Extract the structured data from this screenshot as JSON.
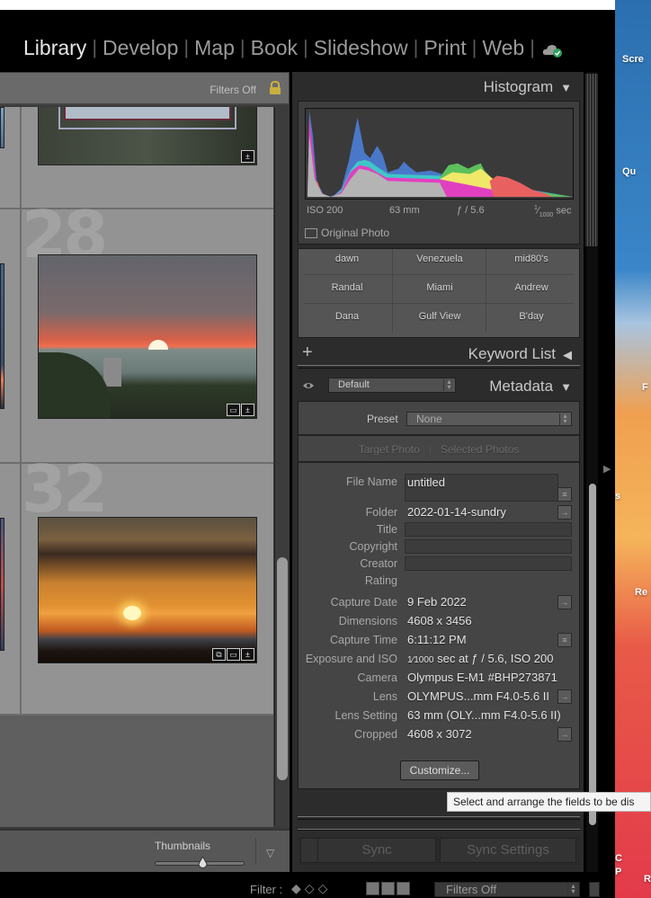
{
  "window": {
    "title_fragment": ""
  },
  "modules": {
    "items": [
      {
        "label": "Library",
        "active": true
      },
      {
        "label": "Develop",
        "active": false
      },
      {
        "label": "Map",
        "active": false
      },
      {
        "label": "Book",
        "active": false
      },
      {
        "label": "Slideshow",
        "active": false
      },
      {
        "label": "Print",
        "active": false
      },
      {
        "label": "Web",
        "active": false
      }
    ],
    "separator": "|",
    "cloud_icon": "cloud-sync-ok-icon"
  },
  "grid": {
    "filter_label": "Filters Off",
    "lock_icon": "lock-icon",
    "cells": [
      {
        "number": "28"
      },
      {
        "number": "32"
      }
    ],
    "badge_icons": [
      "develop-adjusted-icon",
      "crop-icon",
      "virtual-copy-icon"
    ],
    "toolbar": {
      "thumbnails_label": "Thumbnails",
      "thumbnail_size": 0.65,
      "menu_arrow": "▽"
    }
  },
  "histogram": {
    "title": "Histogram",
    "collapse_icon": "▼",
    "iso": "ISO 200",
    "focal": "63 mm",
    "aperture": "ƒ / 5.6",
    "shutter_num": "1",
    "shutter_den": "1000",
    "shutter_unit": "sec",
    "original_photo": "Original Photo"
  },
  "keywords": {
    "rows": [
      [
        "dawn",
        "Venezuela",
        "mid80's"
      ],
      [
        "Randal",
        "Miami",
        "Andrew"
      ],
      [
        "Dana",
        "Gulf View",
        "B'day"
      ]
    ],
    "list_title": "Keyword List",
    "add_icon": "+",
    "expand_icon": "◀"
  },
  "metadata": {
    "title": "Metadata",
    "collapse_icon": "▼",
    "view_preset": "Default",
    "preset_label": "Preset",
    "preset_value": "None",
    "target_photo": "Target Photo",
    "selected_photos": "Selected Photos",
    "fields": {
      "file_name": {
        "label": "File Name",
        "value": "untitled"
      },
      "folder": {
        "label": "Folder",
        "value": "2022-01-14-sundry"
      },
      "title": {
        "label": "Title",
        "value": ""
      },
      "copyright": {
        "label": "Copyright",
        "value": ""
      },
      "creator": {
        "label": "Creator",
        "value": ""
      },
      "rating": {
        "label": "Rating",
        "value": ""
      },
      "capture_date": {
        "label": "Capture Date",
        "value": "9 Feb 2022"
      },
      "dimensions": {
        "label": "Dimensions",
        "value": "4608 x 3456"
      },
      "capture_time": {
        "label": "Capture Time",
        "value": "6:11:12 PM"
      },
      "exposure": {
        "label": "Exposure and ISO",
        "value_frac": "1⁄1000",
        "value": "sec at ƒ / 5.6, ISO 200"
      },
      "camera": {
        "label": "Camera",
        "value": "Olympus E-M1 #BHP273871"
      },
      "lens": {
        "label": "Lens",
        "value": "OLYMPUS...mm F4.0-5.6 II"
      },
      "lens_setting": {
        "label": "Lens Setting",
        "value": "63 mm (OLY...mm F4.0-5.6 II)"
      },
      "cropped": {
        "label": "Cropped",
        "value": "4608 x 3072"
      }
    },
    "customize_label": "Customize...",
    "tooltip": "Select and arrange the fields to be dis"
  },
  "sync": {
    "sync_label": "Sync",
    "sync_settings_label": "Sync Settings"
  },
  "filmstrip": {
    "filter_label": "Filter :",
    "filters_value": "Filters Off"
  },
  "desktop": {
    "labels": [
      "Scre",
      "Qu",
      "F",
      "s",
      "Re",
      "C",
      "P",
      "R"
    ]
  },
  "colors": {
    "accent_active": "#e6e6e6",
    "hist_blue": "#4a78c8",
    "hist_cyan": "#3ec8c8",
    "hist_green": "#5cc05c",
    "hist_yellow": "#f0e868",
    "hist_red": "#e86060",
    "hist_magenta": "#e040c0",
    "hist_gray": "#b4b4b4"
  }
}
